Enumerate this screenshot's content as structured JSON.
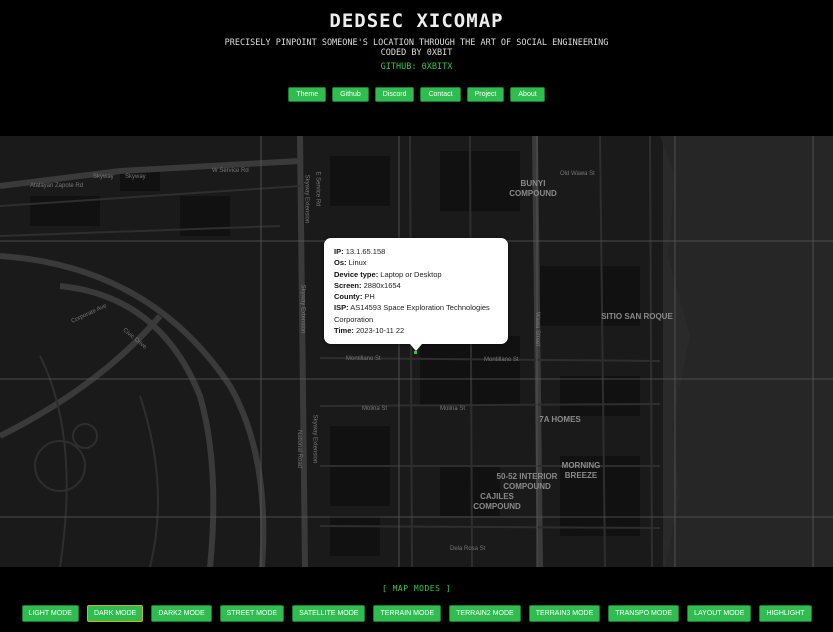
{
  "header": {
    "title": "DEDSEC XICOMAP",
    "subtitle_line1": "PRECISELY PINPOINT SOMEONE'S LOCATION THROUGH THE ART OF SOCIAL ENGINEERING",
    "subtitle_line2": "CODED BY 0XBIT",
    "github": "GITHUB: 0XBITX"
  },
  "nav": {
    "items": [
      "Theme",
      "Github",
      "Discord",
      "Contact",
      "Project",
      "About"
    ]
  },
  "map": {
    "areas": [
      "BUNYI COMPOUND",
      "SITIO SAN ROQUE",
      "7A HOMES",
      "MORNING BREEZE",
      "50-52 INTERIOR COMPOUND",
      "CAJILES COMPOUND"
    ],
    "streets": [
      "Atalayan Zapote Rd",
      "Skyway",
      "Skyway",
      "W Service Rd",
      "Skyway Extension",
      "E Service Rd",
      "Skyway Extension",
      "Montillano St",
      "Montillano St",
      "Molina St",
      "Molina St",
      "Skyway Extension",
      "National Road",
      "Corporate Ave",
      "Civic Drive",
      "Dela Rosa St",
      "Wawa Street",
      "Old Wawa St"
    ],
    "popup": {
      "ip_label": "IP:",
      "ip": "13.1.65.158",
      "os_label": "Os:",
      "os": "Linux",
      "device_label": "Device type:",
      "device": "Laptop or Desktop",
      "screen_label": "Screen:",
      "screen": "2880x1654",
      "county_label": "County:",
      "county": "PH",
      "isp_label": "ISP:",
      "isp": "AS14593 Space Exploration Technologies Corporation",
      "time_label": "Time:",
      "time": "2023-10-11 22"
    }
  },
  "modes": {
    "title": "[ MAP MODES ]",
    "items": [
      "LIGHT MODE",
      "DARK MODE",
      "DARK2 MODE",
      "STREET MODE",
      "SATELLITE MODE",
      "TERRAIN MODE",
      "TERRAIN2 MODE",
      "TERRAIN3 MODE",
      "TRANSPO MODE",
      "LAYOUT MODE",
      "HIGHLIGHT"
    ],
    "active": "DARK MODE"
  },
  "colors": {
    "accent": "#2ebd4e",
    "accent_text": "#2ecc40",
    "active_border": "#d4b300",
    "map_bg": "#1a1a1a"
  }
}
